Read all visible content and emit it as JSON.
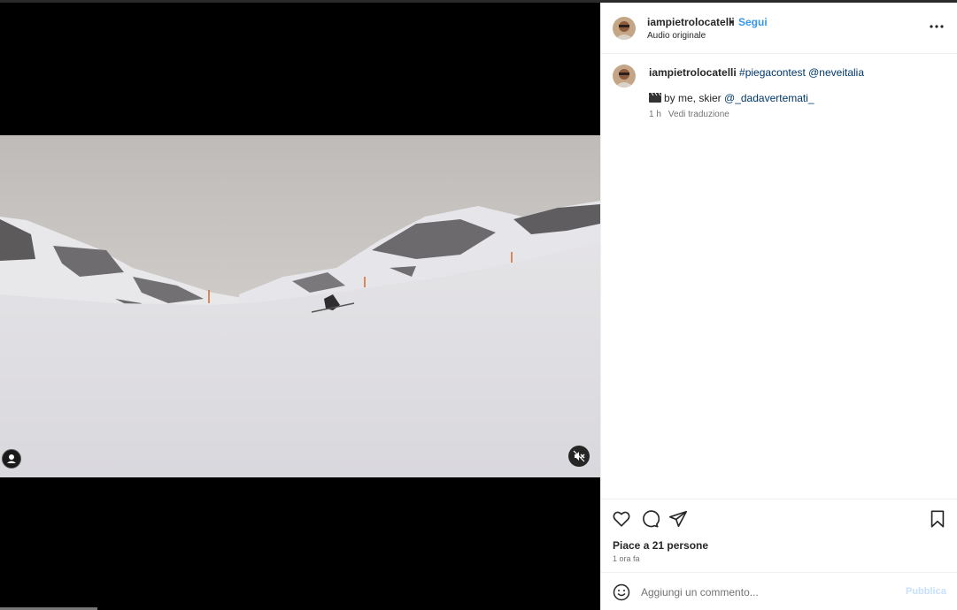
{
  "post": {
    "author": "iampietrolocatelli",
    "separator": "•",
    "follow_label": "Segui",
    "audio": "Audio originale"
  },
  "caption": {
    "username": "iampietrolocatelli",
    "hashtag": "#piegacontest",
    "mention": "@neveitalia",
    "emoji": "clapper-board-emoji",
    "line2_text": "by me, skier ",
    "line2_mention": "@_dadavertemati_",
    "time": "1 h",
    "translate_label": "Vedi traduzione"
  },
  "actions": {
    "like_icon": "heart-icon",
    "comment_icon": "comment-icon",
    "share_icon": "share-icon",
    "save_icon": "bookmark-icon",
    "likes_text": "Piace a 21 persone",
    "posted_time": "1 ora fa"
  },
  "comment": {
    "placeholder": "Aggiungi un commento...",
    "post_label": "Pubblica"
  },
  "colors": {
    "link": "#00376b",
    "follow": "#3797f0",
    "post_disabled": "#c7e0fb",
    "secondary_text": "#737373"
  }
}
